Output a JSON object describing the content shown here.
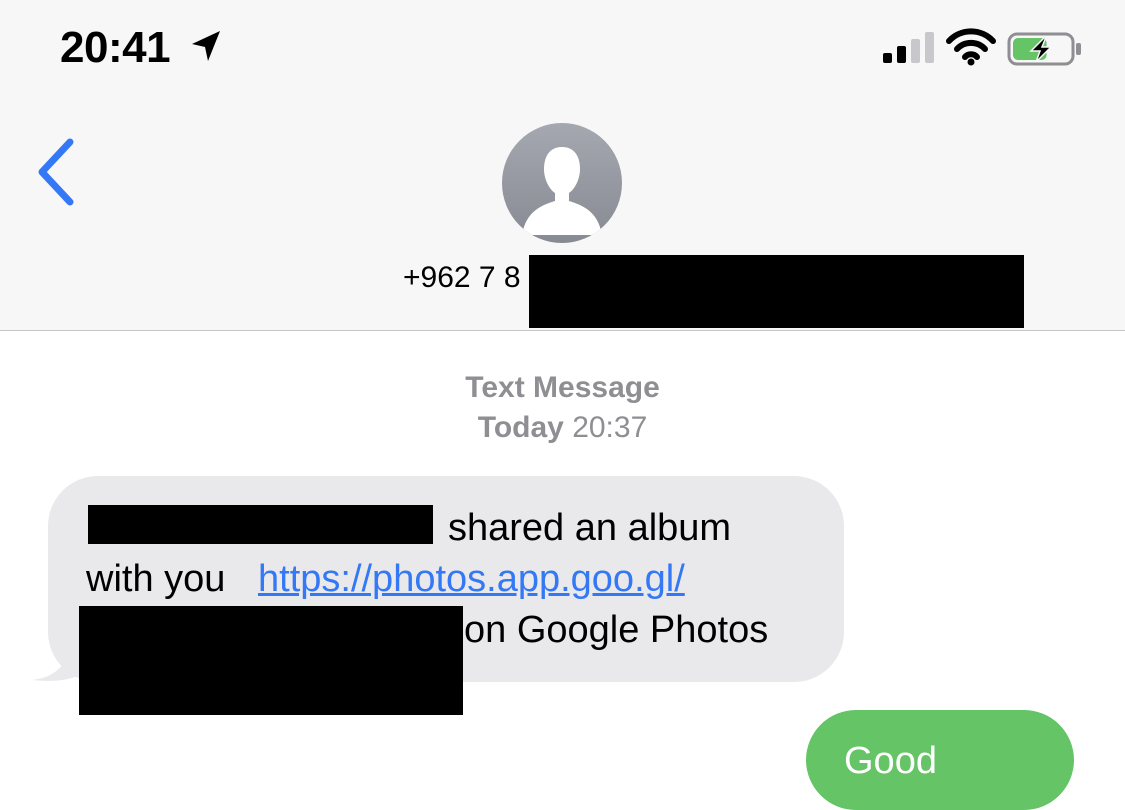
{
  "status_bar": {
    "time": "20:41",
    "location_icon": "location-arrow-icon",
    "signal_icon": "cellular-signal-icon",
    "wifi_icon": "wifi-icon",
    "battery_icon": "battery-charging-icon",
    "battery_level": 0.6,
    "signal_bars_active": 2
  },
  "header": {
    "back_icon": "chevron-left-icon",
    "avatar_icon": "person-silhouette-icon",
    "contact_number": "+962 7 8"
  },
  "conversation": {
    "service_label": "Text Message",
    "day_label": "Today",
    "time_label": "20:37",
    "incoming_message": {
      "line1_text": "shared an album",
      "line2_text": "with you",
      "link_text": "https://photos.app.goo.gl/",
      "line3_text": "on Google Photos"
    },
    "outgoing_message": {
      "text": "Good"
    }
  },
  "colors": {
    "header_background": "#f7f7f7",
    "incoming_bubble": "#e9e9eb",
    "outgoing_bubble": "#65c466",
    "link": "#3478f6",
    "back_chevron": "#3478f6",
    "timestamp_text": "#8e8e93",
    "battery_fill": "#65c466"
  }
}
